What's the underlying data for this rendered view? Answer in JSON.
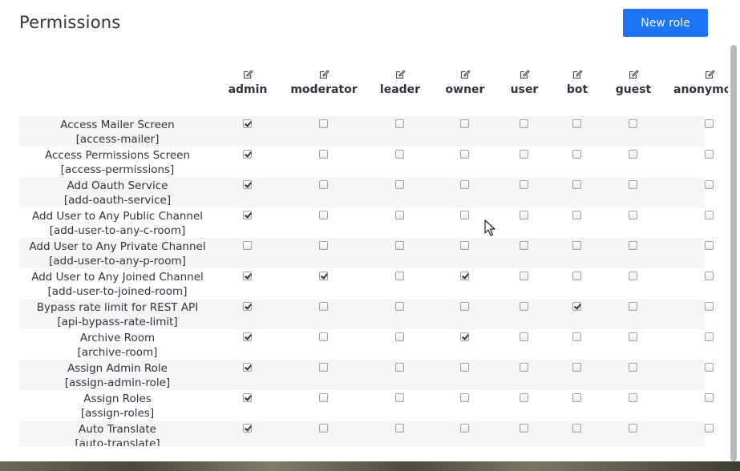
{
  "page": {
    "title": "Permissions",
    "new_role_label": "New role"
  },
  "roles": [
    {
      "label": "admin",
      "icon": "edit-icon"
    },
    {
      "label": "moderator",
      "icon": "edit-icon"
    },
    {
      "label": "leader",
      "icon": "edit-icon"
    },
    {
      "label": "owner",
      "icon": "edit-icon"
    },
    {
      "label": "user",
      "icon": "edit-icon"
    },
    {
      "label": "bot",
      "icon": "edit-icon"
    },
    {
      "label": "guest",
      "icon": "edit-icon"
    },
    {
      "label": "anonymous",
      "icon": "edit-icon"
    }
  ],
  "permissions": [
    {
      "name": "Access Mailer Screen",
      "id": "[access-mailer]",
      "checked": [
        true,
        false,
        false,
        false,
        false,
        false,
        false,
        false
      ]
    },
    {
      "name": "Access Permissions Screen",
      "id": "[access-permissions]",
      "checked": [
        true,
        false,
        false,
        false,
        false,
        false,
        false,
        false
      ]
    },
    {
      "name": "Add Oauth Service",
      "id": "[add-oauth-service]",
      "checked": [
        true,
        false,
        false,
        false,
        false,
        false,
        false,
        false
      ]
    },
    {
      "name": "Add User to Any Public Channel",
      "id": "[add-user-to-any-c-room]",
      "checked": [
        true,
        false,
        false,
        false,
        false,
        false,
        false,
        false
      ]
    },
    {
      "name": "Add User to Any Private Channel",
      "id": "[add-user-to-any-p-room]",
      "checked": [
        false,
        false,
        false,
        false,
        false,
        false,
        false,
        false
      ]
    },
    {
      "name": "Add User to Any Joined Channel",
      "id": "[add-user-to-joined-room]",
      "checked": [
        true,
        true,
        false,
        true,
        false,
        false,
        false,
        false
      ]
    },
    {
      "name": "Bypass rate limit for REST API",
      "id": "[api-bypass-rate-limit]",
      "checked": [
        true,
        false,
        false,
        false,
        false,
        true,
        false,
        false
      ]
    },
    {
      "name": "Archive Room",
      "id": "[archive-room]",
      "checked": [
        true,
        false,
        false,
        true,
        false,
        false,
        false,
        false
      ]
    },
    {
      "name": "Assign Admin Role",
      "id": "[assign-admin-role]",
      "checked": [
        true,
        false,
        false,
        false,
        false,
        false,
        false,
        false
      ]
    },
    {
      "name": "Assign Roles",
      "id": "[assign-roles]",
      "checked": [
        true,
        false,
        false,
        false,
        false,
        false,
        false,
        false
      ]
    },
    {
      "name": "Auto Translate",
      "id": "[auto-translate]",
      "checked": [
        true,
        false,
        false,
        false,
        false,
        false,
        false,
        false
      ]
    }
  ],
  "colors": {
    "accent": "#1d74f5",
    "row_shade": "#f5f5f5",
    "text": "#2f343d"
  }
}
